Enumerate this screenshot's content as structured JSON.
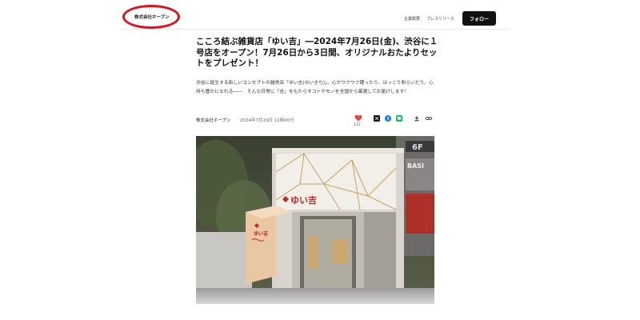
{
  "header": {
    "company_name": "株式会社ホーブン",
    "nav": [
      {
        "label": "企業概要"
      },
      {
        "label": "プレスリリース"
      }
    ],
    "follow_label": "フォロー"
  },
  "article": {
    "title": "こころ結ぶ雑貨店「ゆい吉」―2024年7月26日(金)、渋谷に１号店をオープン！7月26日から3日間、オリジナルおたよりセットをプレゼント！",
    "lead": "渋谷に誕生する新しいコンセプトの雑貨店「ゆい吉(ゆいきち)」。心がワクワク躍ったり、ほっこり和らいだり、心持ち豊かになれる――　そんな日常に「吉」をもたらすコトやモノを全国から厳選してお届けします！",
    "company": "株式会社ホーブン",
    "date": "2024年7月19日 11時00分",
    "like_count": "212"
  },
  "image": {
    "sign_main": "ゆい吉",
    "sign_side": "ゆい吉",
    "building_sign_top": "6F",
    "building_sign_sub": "BASI"
  },
  "colors": {
    "accent_red": "#e0101b",
    "like_red": "#e8453c",
    "follow_bg": "#111111",
    "facebook": "#1877f2",
    "line": "#06c755"
  },
  "icons": [
    "heart-icon",
    "x-share-icon",
    "facebook-share-icon",
    "line-share-icon",
    "download-icon",
    "link-icon"
  ]
}
